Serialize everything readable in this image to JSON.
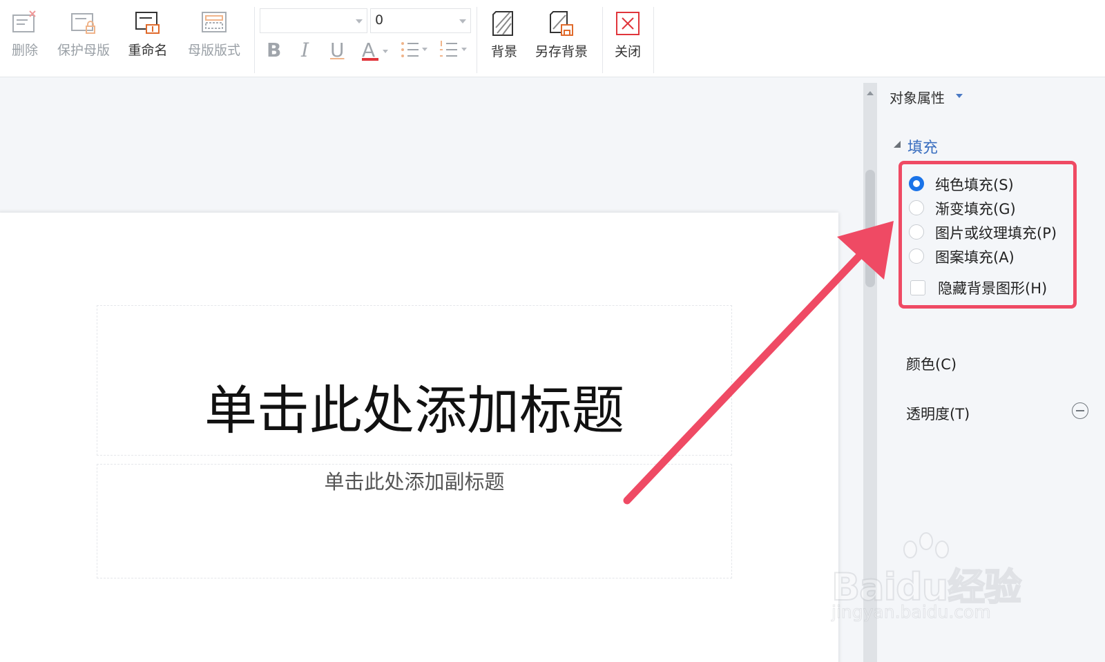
{
  "toolbar": {
    "group1": [
      {
        "label": "删除",
        "icon": "delete-master-icon",
        "enabled": false
      },
      {
        "label": "保护母版",
        "icon": "protect-master-icon",
        "enabled": false
      },
      {
        "label": "重命名",
        "icon": "rename-icon",
        "enabled": true
      },
      {
        "label": "母版版式",
        "icon": "master-layout-icon",
        "enabled": false
      }
    ],
    "font_name": "",
    "font_size": "0",
    "format_buttons": [
      "B",
      "I",
      "U",
      "A"
    ],
    "group2": [
      {
        "label": "背景",
        "icon": "background-icon",
        "enabled": true
      },
      {
        "label": "另存背景",
        "icon": "save-background-icon",
        "enabled": true
      }
    ],
    "close": {
      "label": "关闭",
      "icon": "close-icon",
      "enabled": true
    }
  },
  "slide": {
    "title_placeholder": "单击此处添加标题",
    "subtitle_placeholder": "单击此处添加副标题"
  },
  "panel": {
    "title": "对象属性",
    "section": "填充",
    "fill_options": [
      {
        "label": "纯色填充(S)",
        "checked": true
      },
      {
        "label": "渐变填充(G)",
        "checked": false
      },
      {
        "label": "图片或纹理填充(P)",
        "checked": false
      },
      {
        "label": "图案填充(A)",
        "checked": false
      }
    ],
    "hide_bg_checkbox": {
      "label": "隐藏背景图形(H)",
      "checked": false
    },
    "color_label": "颜色(C)",
    "transparency_label": "透明度(T)"
  },
  "watermark": {
    "brand": "Baidu经验",
    "url": "jingyan.baidu.com"
  },
  "colors": {
    "accent": "#1a73e8",
    "highlight": "#ef4a64",
    "section_header": "#3a6fc0",
    "close_red": "#e0353b"
  }
}
